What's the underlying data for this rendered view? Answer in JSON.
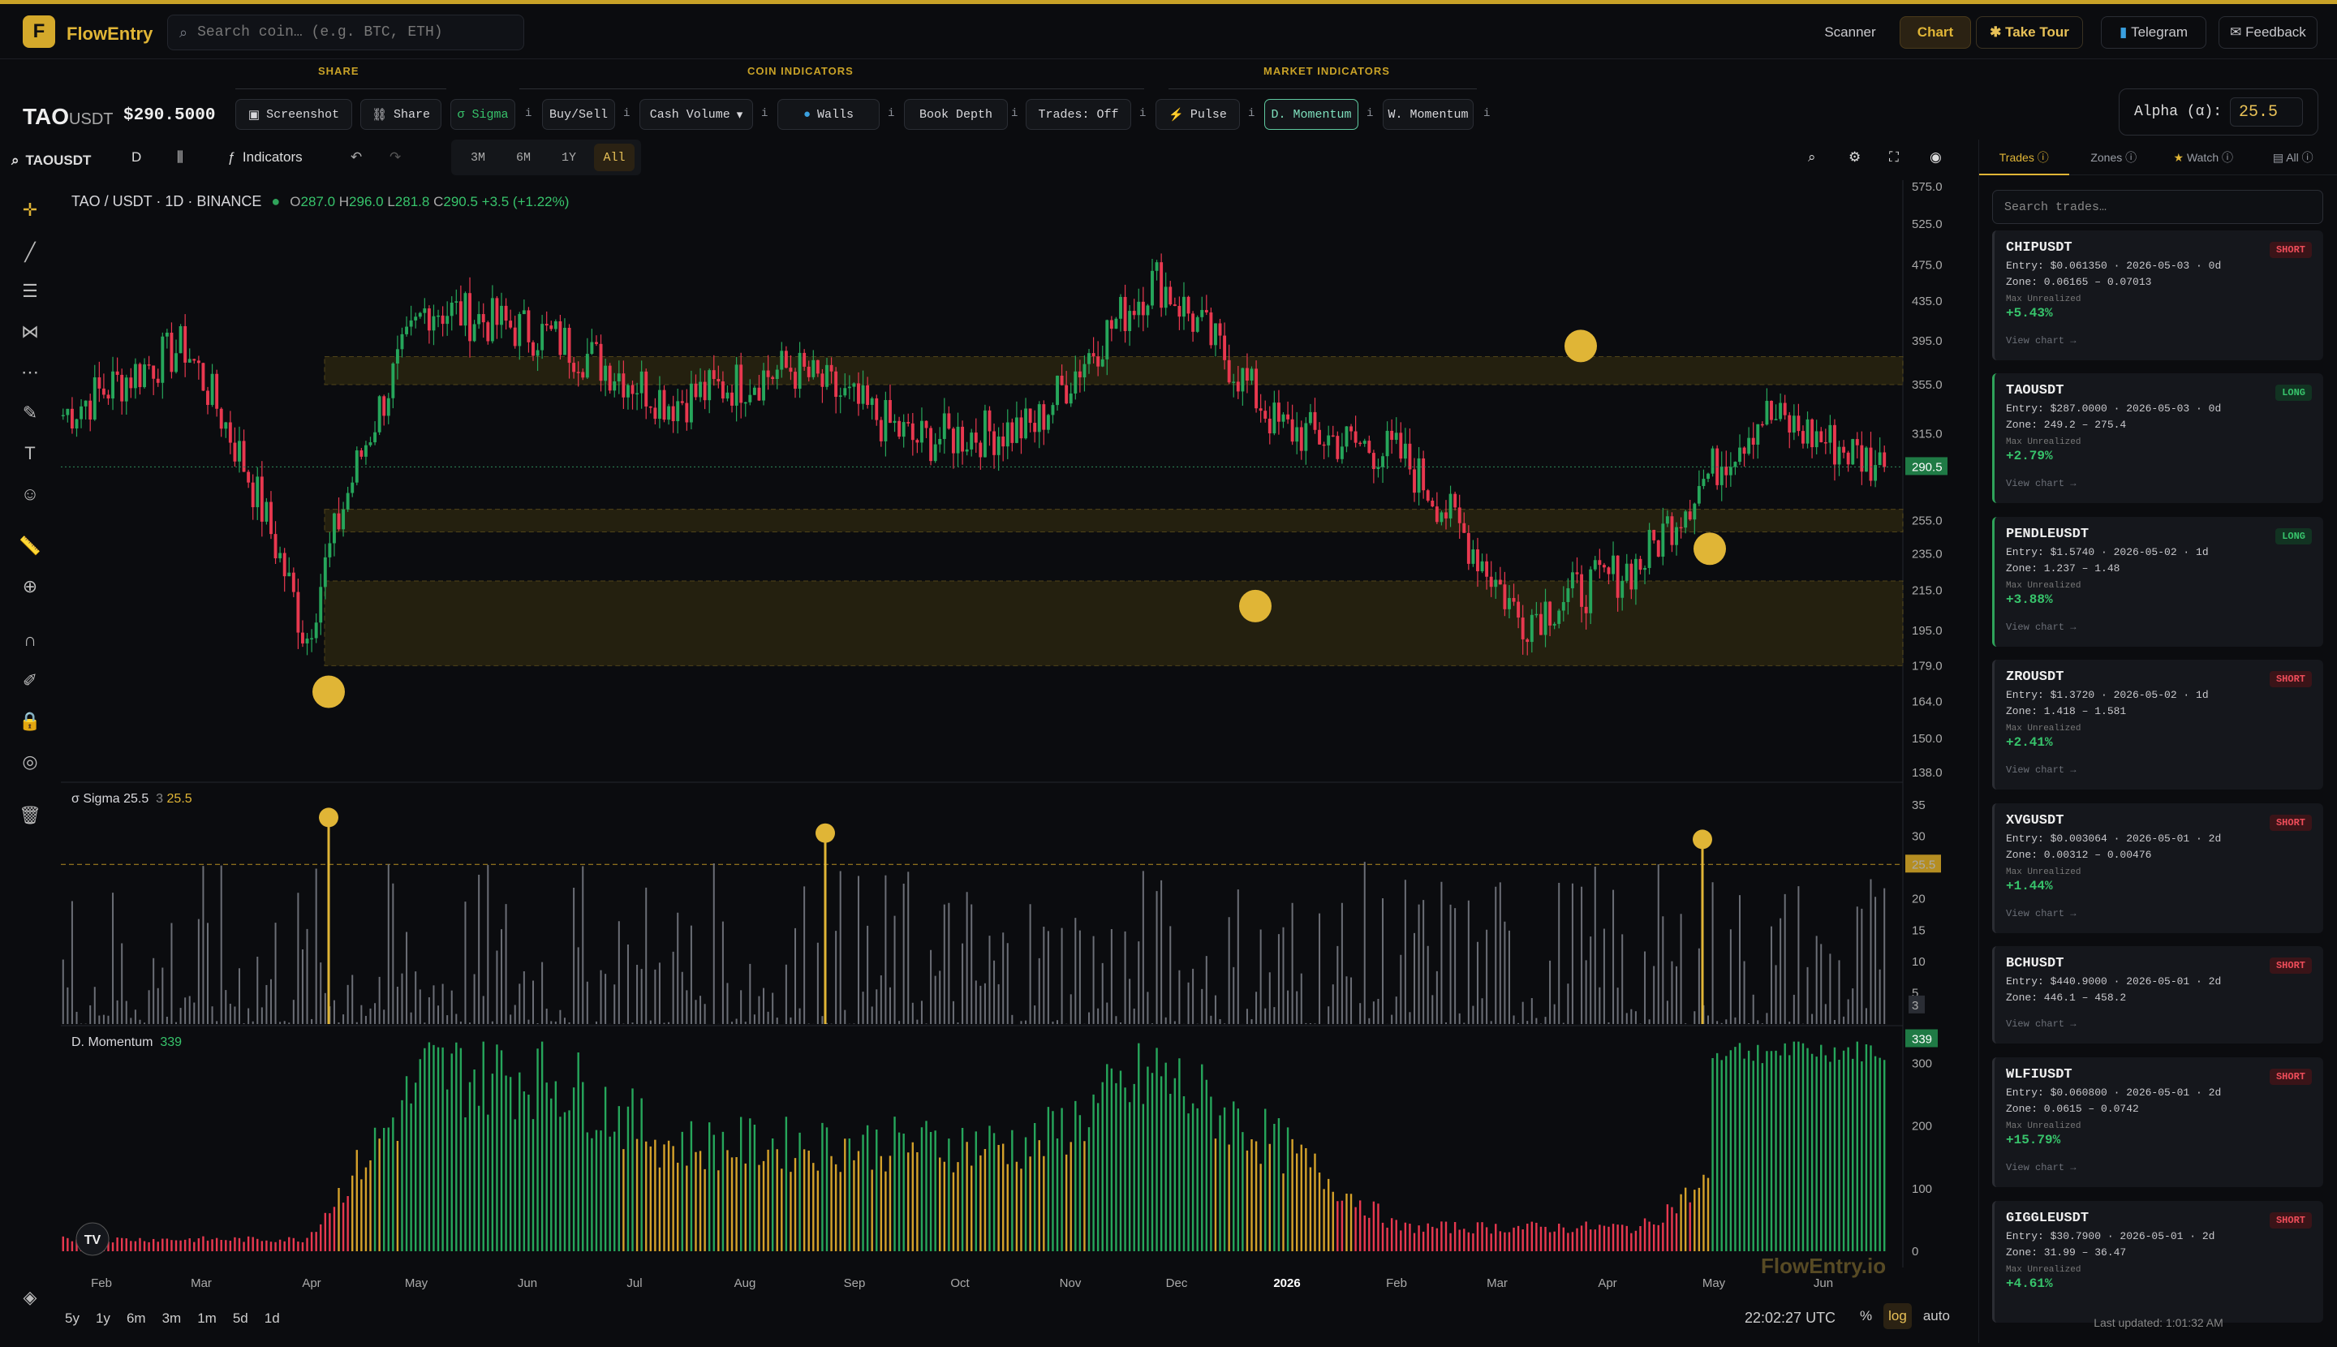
{
  "app": {
    "name": "FlowEntry",
    "logo_letter": "F",
    "accent": "#c9a227"
  },
  "search": {
    "placeholder": "Search coin… (e.g. BTC, ETH)"
  },
  "nav": {
    "scanner": "Scanner",
    "chart": "Chart",
    "tour": "Take Tour",
    "telegram": "Telegram",
    "feedback": "Feedback"
  },
  "sections": {
    "share": "SHARE",
    "coin": "COIN INDICATORS",
    "market": "MARKET INDICATORS"
  },
  "ticker": {
    "base": "TAO",
    "quote": "USDT",
    "price": "$290.5000"
  },
  "toolbar": {
    "screenshot": "Screenshot",
    "share": "Share",
    "sigma": "σ Sigma",
    "buysell": "Buy/Sell",
    "cashvol": "Cash Volume",
    "walls": "Walls",
    "bookdepth": "Book Depth",
    "trades": "Trades: Off",
    "pulse": "Pulse",
    "dmomentum": "D. Momentum",
    "wmomentum": "W. Momentum",
    "info": "i"
  },
  "alpha": {
    "label": "Alpha (α):",
    "value": "25.5"
  },
  "chart_header": {
    "symbol": "TAOUSDT",
    "interval": "D",
    "indicators": "Indicators"
  },
  "ranges": [
    "3M",
    "6M",
    "1Y",
    "All"
  ],
  "range_active": "All",
  "legend": {
    "title": "TAO / USDT · 1D · BINANCE",
    "o_label": "O",
    "o": "287.0",
    "h_label": "H",
    "h": "296.0",
    "l_label": "L",
    "l": "281.8",
    "c_label": "C",
    "c": "290.5",
    "chg": "+3.5 (+1.22%)"
  },
  "sigma_pane": {
    "title": "σ Sigma 25.5",
    "v1": "3",
    "v2": "25.5",
    "threshold": 25.5
  },
  "mom_pane": {
    "title": "D. Momentum",
    "value": "339"
  },
  "price_axis": [
    "575.0",
    "525.0",
    "475.0",
    "435.0",
    "395.0",
    "355.0",
    "315.0",
    "290.5",
    "255.0",
    "235.0",
    "215.0",
    "195.0",
    "179.0",
    "164.0",
    "150.0",
    "138.0"
  ],
  "sigma_axis": [
    "35",
    "30",
    "25.5",
    "20",
    "15",
    "10",
    "5",
    "3"
  ],
  "mom_axis": [
    "339",
    "300",
    "200",
    "100",
    "0"
  ],
  "x_axis": [
    "Feb",
    "Mar",
    "Apr",
    "May",
    "Jun",
    "Jul",
    "Aug",
    "Sep",
    "Oct",
    "Nov",
    "Dec",
    "2026",
    "Feb",
    "Mar",
    "Apr",
    "May",
    "Jun"
  ],
  "bottom": {
    "periods": [
      "5y",
      "1y",
      "6m",
      "3m",
      "1m",
      "5d",
      "1d"
    ],
    "utc": "22:02:27 UTC",
    "pct": "%",
    "log": "log",
    "auto": "auto"
  },
  "watermark": "FlowEntry.io",
  "right_tabs": [
    "Trades",
    "Zones",
    "Watch",
    "All"
  ],
  "trade_search": "Search trades…",
  "trades": [
    {
      "sym": "CHIPUSDT",
      "side": "SHORT",
      "entry": "Entry: $0.061350 · 2026-05-03 · 0d",
      "zone": "Zone: 0.06165 – 0.07013",
      "mu": "Max Unrealized",
      "pnl": "+5.43%",
      "view": "View chart →"
    },
    {
      "sym": "TAOUSDT",
      "side": "LONG",
      "entry": "Entry: $287.0000 · 2026-05-03 · 0d",
      "zone": "Zone: 249.2 – 275.4",
      "mu": "Max Unrealized",
      "pnl": "+2.79%",
      "view": "View chart →"
    },
    {
      "sym": "PENDLEUSDT",
      "side": "LONG",
      "entry": "Entry: $1.5740 · 2026-05-02 · 1d",
      "zone": "Zone: 1.237 – 1.48",
      "mu": "Max Unrealized",
      "pnl": "+3.88%",
      "view": "View chart →"
    },
    {
      "sym": "ZROUSDT",
      "side": "SHORT",
      "entry": "Entry: $1.3720 · 2026-05-02 · 1d",
      "zone": "Zone: 1.418 – 1.581",
      "mu": "Max Unrealized",
      "pnl": "+2.41%",
      "view": "View chart →"
    },
    {
      "sym": "XVGUSDT",
      "side": "SHORT",
      "entry": "Entry: $0.003064 · 2026-05-01 · 2d",
      "zone": "Zone: 0.00312 – 0.00476",
      "mu": "Max Unrealized",
      "pnl": "+1.44%",
      "view": "View chart →"
    },
    {
      "sym": "BCHUSDT",
      "side": "SHORT",
      "entry": "Entry: $440.9000 · 2026-05-01 · 2d",
      "zone": "Zone: 446.1 – 458.2",
      "mu": "",
      "pnl": "",
      "view": "View chart →"
    },
    {
      "sym": "WLFIUSDT",
      "side": "SHORT",
      "entry": "Entry: $0.060800 · 2026-05-01 · 2d",
      "zone": "Zone: 0.0615 – 0.0742",
      "mu": "Max Unrealized",
      "pnl": "+15.79%",
      "view": "View chart →"
    },
    {
      "sym": "GIGGLEUSDT",
      "side": "SHORT",
      "entry": "Entry: $30.7900 · 2026-05-01 · 2d",
      "zone": "Zone: 31.99 – 36.47",
      "mu": "Max Unrealized",
      "pnl": "+4.61%",
      "view": ""
    }
  ],
  "last_updated": "Last updated: 1:01:32 AM",
  "colors": {
    "up": "#26a65b",
    "down": "#e8384f",
    "zone": "#3a3110",
    "marker": "#e0b536",
    "momentum_mid": "#d4a12a"
  },
  "chart_data": {
    "type": "candlestick",
    "title": "TAO / USDT · 1D · BINANCE",
    "x_categories": [
      "Feb",
      "Mar",
      "Apr",
      "May",
      "Jun",
      "Jul",
      "Aug",
      "Sep",
      "Oct",
      "Nov",
      "Dec",
      "2026",
      "Feb",
      "Mar",
      "Apr",
      "May",
      "Jun"
    ],
    "monthly_closes": [
      330,
      390,
      190,
      430,
      400,
      340,
      370,
      310,
      320,
      460,
      320,
      300,
      200,
      230,
      330,
      290.5
    ],
    "y_scale": "log",
    "ylim": [
      138,
      575
    ],
    "last_price": 290.5,
    "zones": [
      {
        "low": 179,
        "high": 220
      },
      {
        "low": 355,
        "high": 380
      },
      {
        "low": 248,
        "high": 262
      }
    ],
    "sigma_threshold": 25.5,
    "momentum_last": 339
  }
}
